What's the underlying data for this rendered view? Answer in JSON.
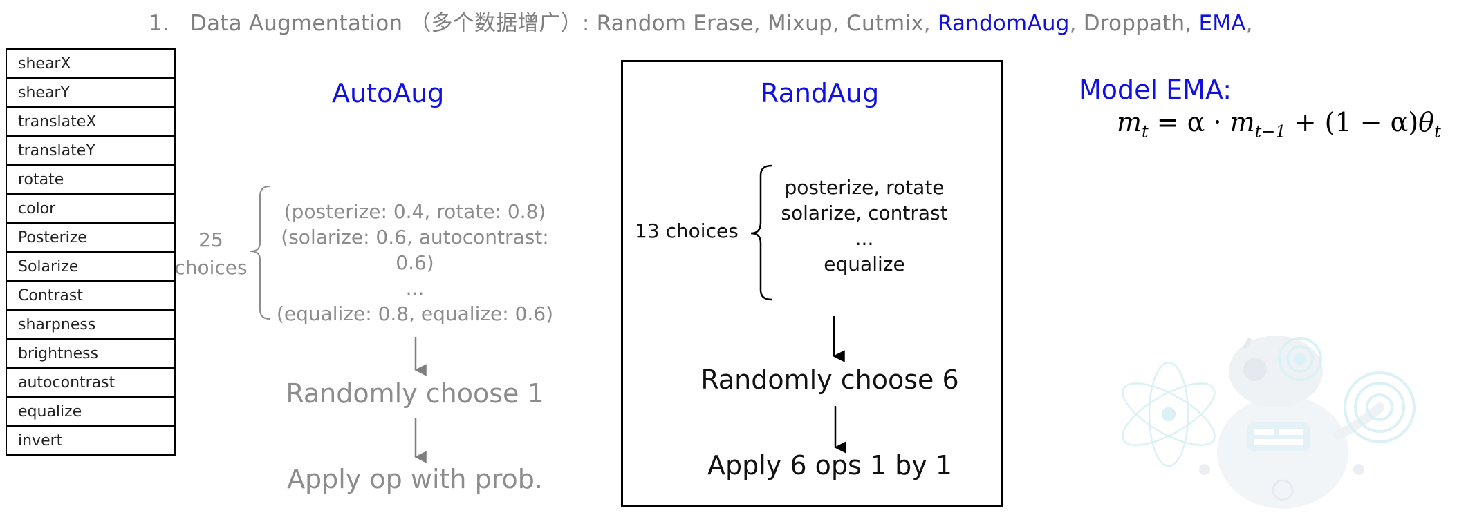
{
  "heading": {
    "number": "1.",
    "prefix": "Data Augmentation （多个数据增广）: Random Erase, Mixup, Cutmix, ",
    "rand_aug": "RandomAug",
    "middle": ", Droppath, ",
    "ema": "EMA",
    "suffix": ","
  },
  "ops": [
    "shearX",
    "shearY",
    "translateX",
    "translateY",
    "rotate",
    "color",
    "Posterize",
    "Solarize",
    "Contrast",
    "sharpness",
    "brightness",
    "autocontrast",
    "equalize",
    "invert"
  ],
  "autoaug": {
    "title": "AutoAug",
    "count_num": "25",
    "count_word": "choices",
    "lines": [
      "(posterize: 0.4, rotate: 0.8)",
      "(solarize: 0.6, autocontrast: 0.6)",
      "...",
      "(equalize: 0.8, equalize: 0.6)"
    ],
    "choose": "Randomly choose 1",
    "apply": "Apply op with prob."
  },
  "randaug": {
    "title": "RandAug",
    "count": "13 choices",
    "lines": [
      "posterize, rotate",
      "solarize, contrast",
      "...",
      "equalize"
    ],
    "choose": "Randomly choose 6",
    "apply": "Apply 6 ops 1 by 1"
  },
  "ema": {
    "title": "Model EMA:",
    "lhs": "m",
    "lhs_sub": "t",
    "eq": " = α · ",
    "m": "m",
    "m_sub": "t−1",
    "plus": " + (1 − α)",
    "theta": "θ",
    "theta_sub": "t"
  },
  "colors": {
    "accent": "#1010e0",
    "muted": "#8c8c8c",
    "text": "#000000"
  },
  "decoration": "robot-illustration"
}
